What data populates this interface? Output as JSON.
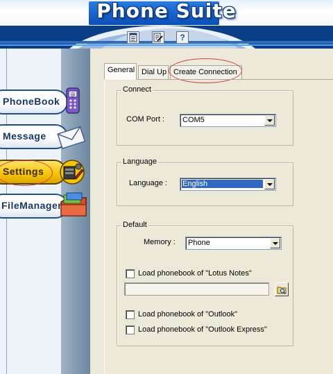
{
  "app": {
    "title": "Phone Suite"
  },
  "toolbar": {
    "buttons": [
      {
        "icon": "notepad-icon"
      },
      {
        "icon": "edit-document-icon"
      },
      {
        "icon": "help-icon",
        "glyph": "?"
      }
    ]
  },
  "sidebar": {
    "items": [
      {
        "label": "PhoneBook",
        "icon": "phone-icon",
        "active": false
      },
      {
        "label": "Message",
        "icon": "envelope-icon",
        "active": false
      },
      {
        "label": "Settings",
        "icon": "tools-icon",
        "active": true
      },
      {
        "label": "FileManager",
        "icon": "folder-icon",
        "active": false
      }
    ]
  },
  "tabs": [
    {
      "label": "General",
      "active": true
    },
    {
      "label": "Dial Up",
      "active": false
    },
    {
      "label": "Create Connection",
      "active": false
    }
  ],
  "connect": {
    "title": "Connect",
    "com_port_label": "COM Port :",
    "com_port_value": "COM5"
  },
  "language": {
    "title": "Language",
    "label": "Language :",
    "value": "English"
  },
  "default": {
    "title": "Default",
    "memory_label": "Memory :",
    "memory_value": "Phone",
    "lotus_label": "Load phonebook of \"Lotus Notes\"",
    "lotus_checked": false,
    "path_value": "",
    "outlook_label": "Load phonebook of \"Outlook\"",
    "outlook_checked": false,
    "outlook_express_label": "Load phonebook of \"Outlook Express\"",
    "outlook_express_checked": false
  },
  "colors": {
    "accent": "#0a3f87",
    "active_nav": "#f5c400",
    "highlight_ring": "#d23a3a",
    "panel": "#ece9d8",
    "selection": "#316ac5"
  }
}
